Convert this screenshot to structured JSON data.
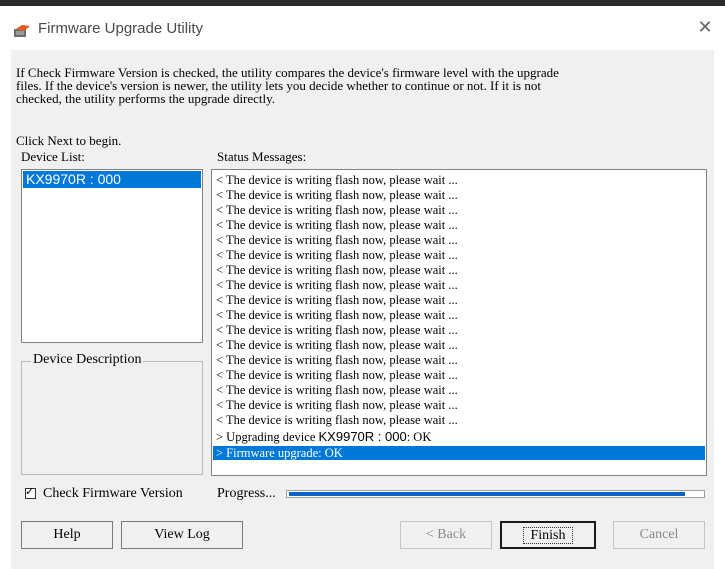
{
  "window": {
    "title": "Firmware Upgrade Utility",
    "close_glyph": "✕"
  },
  "intro": {
    "text": "If Check Firmware Version is checked, the utility compares the device's firmware level with the upgrade\nfiles. If the device's version is newer, the utility lets you decide whether to continue or not. If it is not\nchecked, the utility performs the upgrade directly.",
    "begin": "Click Next to begin."
  },
  "device_list": {
    "label": "Device List:",
    "items": [
      "KX9970R : 000"
    ]
  },
  "device_description": {
    "label": "Device Description"
  },
  "status": {
    "label": "Status Messages:",
    "wait_line": "< The device is writing flash now, please wait ...",
    "upgrading_prefix": "> Upgrading device ",
    "upgrading_device": "KX9970R : 000",
    "upgrading_suffix": ": OK",
    "final_line": "> Firmware upgrade: OK"
  },
  "options": {
    "check_firmware_label": "Check Firmware Version",
    "check_firmware_checked": true,
    "check_mark": "✓"
  },
  "progress": {
    "label": "Progress...",
    "fraction": 0.96
  },
  "buttons": {
    "help": "Help",
    "view_log": "View Log",
    "back": "< Back",
    "finish": "Finish",
    "cancel": "Cancel"
  }
}
